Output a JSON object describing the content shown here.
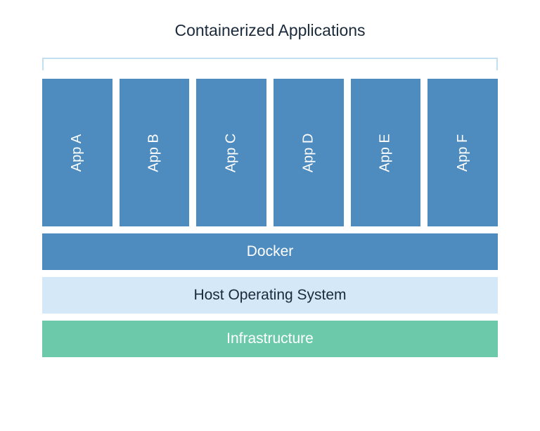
{
  "title": "Containerized Applications",
  "apps": {
    "0": "App A",
    "1": "App B",
    "2": "App C",
    "3": "App D",
    "4": "App E",
    "5": "App F"
  },
  "layers": {
    "docker": "Docker",
    "host": "Host Operating System",
    "infrastructure": "Infrastructure"
  },
  "colors": {
    "blue": "#4e8cc0",
    "lightblue": "#d4e8f7",
    "bracketblue": "#c0dff2",
    "green": "#6ccaaa",
    "titletext": "#1a2a3a"
  }
}
